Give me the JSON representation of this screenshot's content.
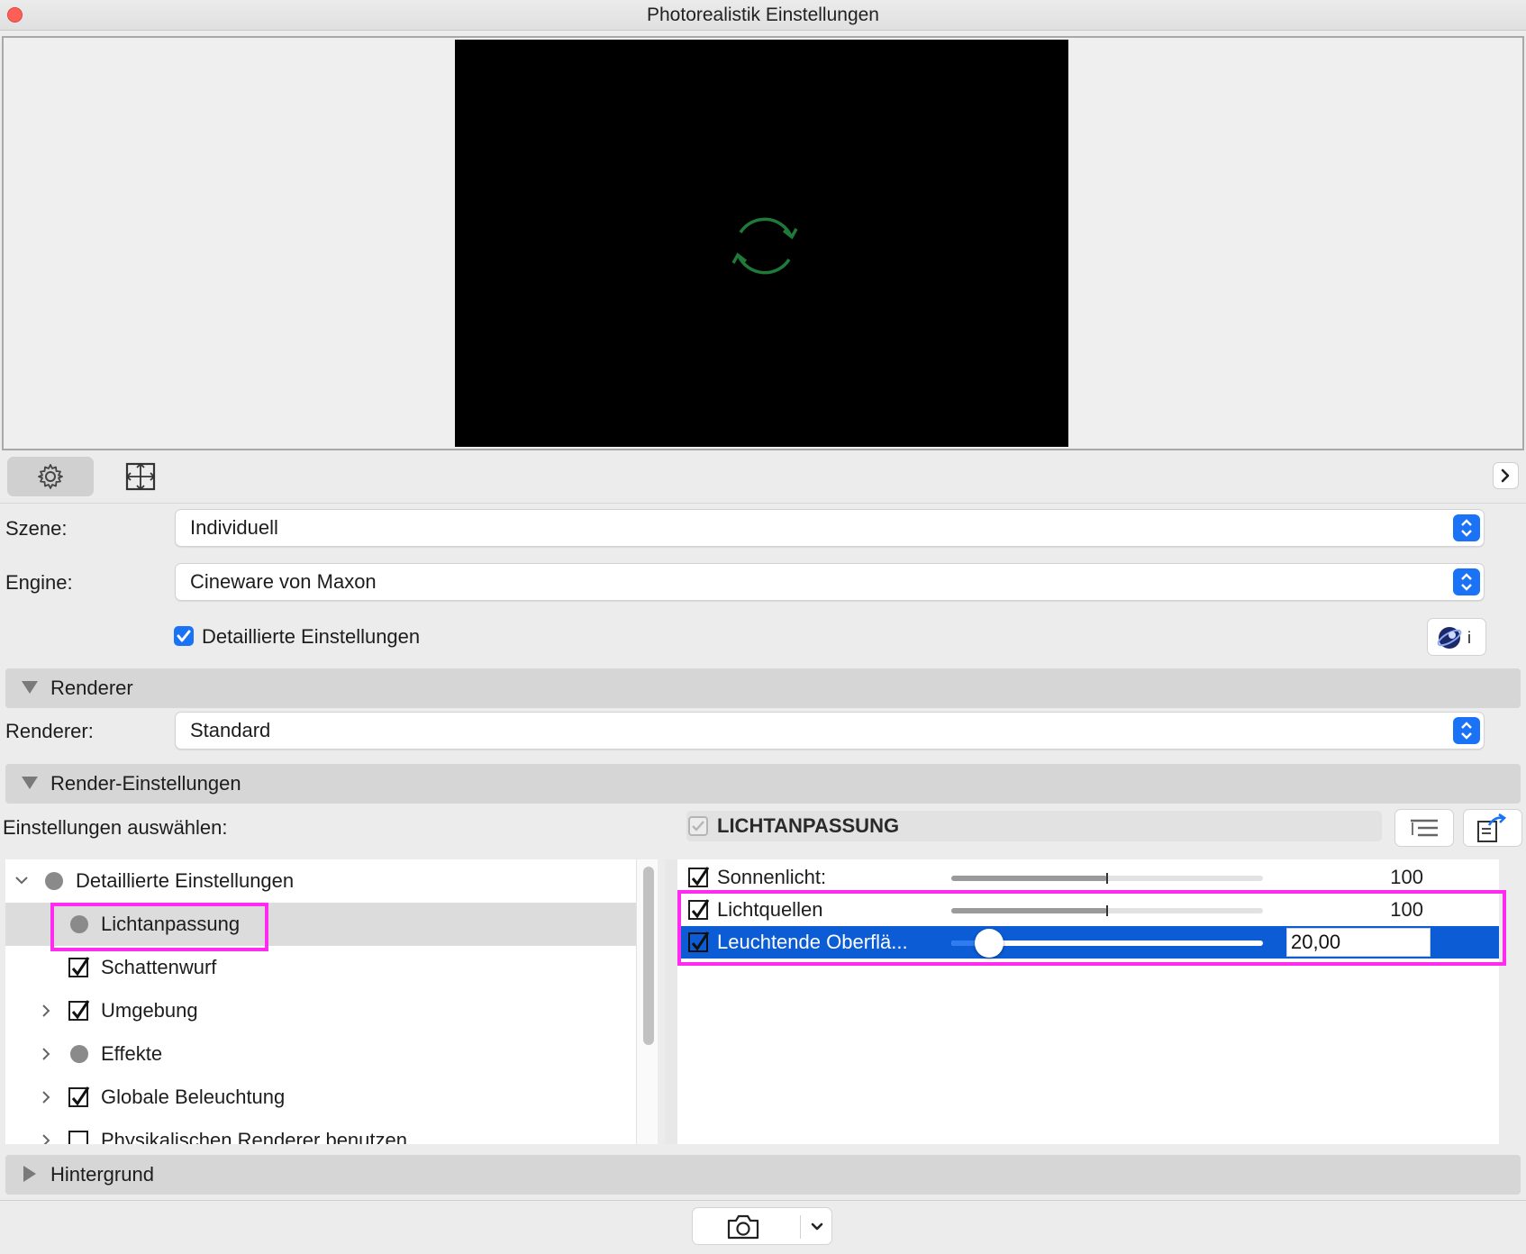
{
  "window": {
    "title": "Photorealistik Einstellungen"
  },
  "form": {
    "scene_label": "Szene:",
    "scene_value": "Individuell",
    "engine_label": "Engine:",
    "engine_value": "Cineware von Maxon",
    "detailed_label": "Detaillierte Einstellungen",
    "detailed_checked": true,
    "info_label": "i"
  },
  "sections": {
    "renderer": "Renderer",
    "render_settings": "Render-Einstellungen",
    "background": "Hintergrund"
  },
  "renderer": {
    "label": "Renderer:",
    "value": "Standard"
  },
  "settings_select": {
    "label": "Einstellungen auswählen:",
    "panel_title": "LICHTANPASSUNG"
  },
  "tree": {
    "items": [
      {
        "label": "Detaillierte Einstellungen",
        "state": "dot",
        "expanded": true
      },
      {
        "label": "Lichtanpassung",
        "state": "dot",
        "selected": true
      },
      {
        "label": "Schattenwurf",
        "state": "checked"
      },
      {
        "label": "Umgebung",
        "state": "checked",
        "collapsed": true
      },
      {
        "label": "Effekte",
        "state": "dot",
        "collapsed": true
      },
      {
        "label": "Globale Beleuchtung",
        "state": "checked",
        "collapsed": true
      },
      {
        "label": "Physikalischen Renderer benutzen",
        "state": "unchecked",
        "collapsed": true
      }
    ]
  },
  "properties": [
    {
      "label": "Sonnenlicht:",
      "value": "100",
      "level": 0.5,
      "checked": true
    },
    {
      "label": "Lichtquellen",
      "value": "100",
      "level": 0.5,
      "checked": true
    },
    {
      "label": "Leuchtende Oberflä...",
      "value": "20,00",
      "level": 0.12,
      "checked": true,
      "selected": true
    }
  ],
  "colors": {
    "accent": "#1a72f7",
    "selection": "#0b5cd5",
    "highlight": "#ff2bf0"
  },
  "icons": [
    "refresh-icon",
    "gear-icon",
    "frame-icon",
    "chevron-right-icon",
    "stepper-icon",
    "cineware-info-icon",
    "list-view-icon",
    "export-icon",
    "camera-icon",
    "chevron-down-icon"
  ]
}
